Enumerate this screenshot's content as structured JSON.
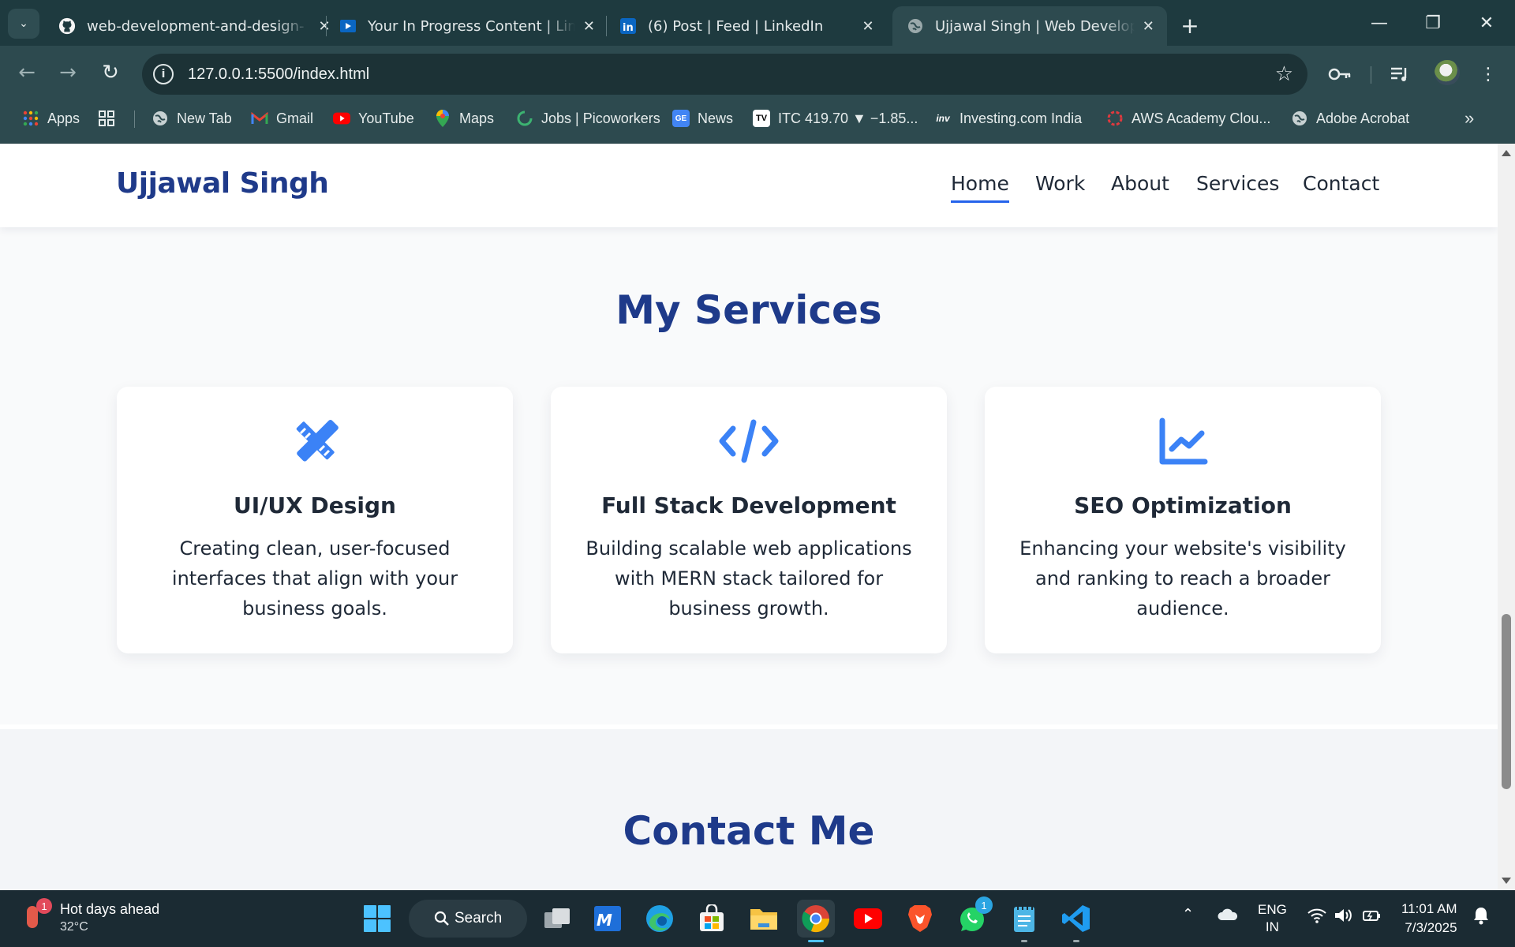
{
  "browser": {
    "tabs": [
      {
        "title": "web-development-and-design-",
        "icon": "github-icon",
        "active": false
      },
      {
        "title": "Your In Progress Content | Linkedi",
        "icon": "linkedin-learning-icon",
        "active": false
      },
      {
        "title": "(6) Post | Feed | LinkedIn",
        "icon": "linkedin-icon",
        "active": false
      },
      {
        "title": "Ujjawal Singh | Web Developer |",
        "icon": "globe-icon",
        "active": true
      }
    ],
    "address": "127.0.0.1:5500/index.html",
    "bookmarks": [
      {
        "label": "Apps",
        "icon": "apps-grid-icon"
      },
      {
        "label": "New Tab",
        "icon": "globe-icon"
      },
      {
        "label": "Gmail",
        "icon": "gmail-icon"
      },
      {
        "label": "YouTube",
        "icon": "youtube-icon"
      },
      {
        "label": "Maps",
        "icon": "maps-pin-icon"
      },
      {
        "label": "Jobs | Picoworkers",
        "icon": "picoworkers-icon"
      },
      {
        "label": "News",
        "icon": "google-news-icon"
      },
      {
        "label": "ITC 419.70 ▼ −1.85...",
        "icon": "tradingview-icon"
      },
      {
        "label": "Investing.com India",
        "icon": "investing-icon"
      },
      {
        "label": "AWS Academy Clou...",
        "icon": "aws-academy-icon"
      },
      {
        "label": "Adobe Acrobat",
        "icon": "globe-icon"
      }
    ]
  },
  "site": {
    "brand": "Ujjawal Singh",
    "nav": [
      "Home",
      "Work",
      "About",
      "Services",
      "Contact"
    ],
    "active_nav": "Home",
    "services_title": "My Services",
    "services": [
      {
        "icon": "pencil-ruler-icon",
        "title": "UI/UX Design",
        "text": "Creating clean, user-focused interfaces that align with your business goals."
      },
      {
        "icon": "code-icon",
        "title": "Full Stack Development",
        "text": "Building scalable web applications with MERN stack tailored for business growth."
      },
      {
        "icon": "chart-line-icon",
        "title": "SEO Optimization",
        "text": "Enhancing your website's visibility and ranking to reach a broader audience."
      }
    ],
    "contact_title": "Contact Me",
    "accent": "#2563eb",
    "heading_color": "#1e3a8a",
    "icon_color": "#3b82f6"
  },
  "taskbar": {
    "weather_title": "Hot days ahead",
    "weather_temp": "32°C",
    "weather_badge": "1",
    "search_label": "Search",
    "whatsapp_badge": "1",
    "lang_line1": "ENG",
    "lang_line2": "IN",
    "time": "11:01 AM",
    "date": "7/3/2025"
  }
}
